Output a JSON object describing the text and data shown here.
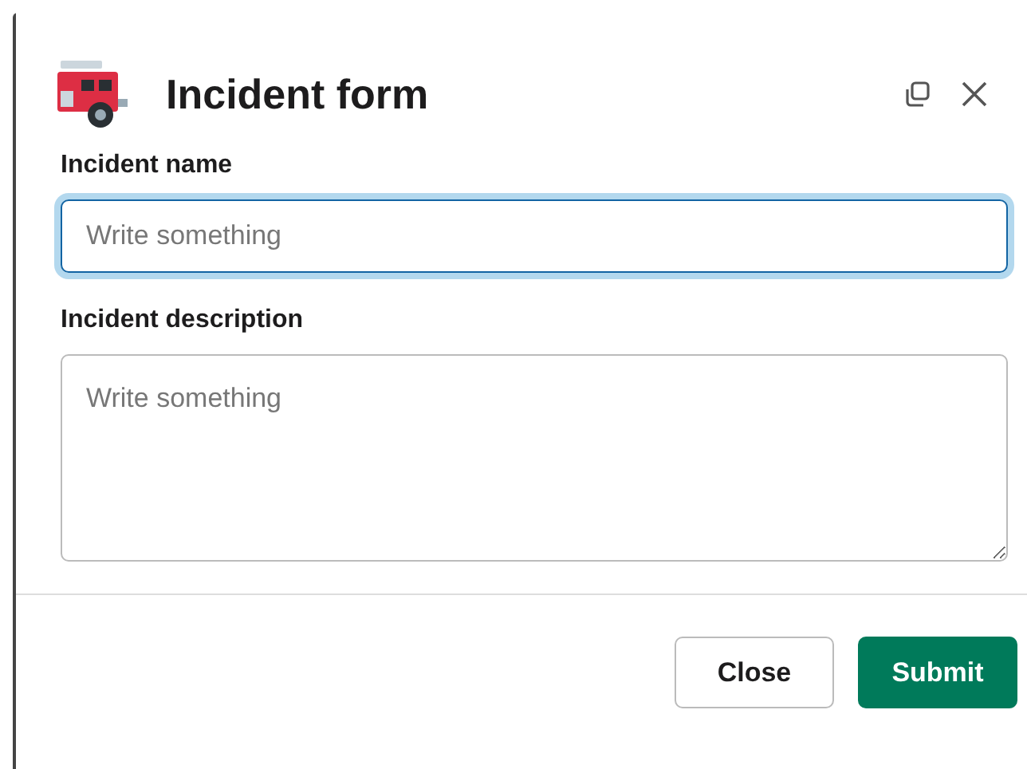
{
  "dialog": {
    "title": "Incident form"
  },
  "fields": [
    {
      "kind": "input",
      "label": "Incident name",
      "placeholder": "Write something",
      "focused": true
    },
    {
      "kind": "textarea",
      "label": "Incident description",
      "placeholder": "Write something",
      "focused": false
    }
  ],
  "buttons": [
    {
      "kind": "secondary",
      "label": "Close"
    },
    {
      "kind": "primary",
      "label": "Submit"
    }
  ]
}
